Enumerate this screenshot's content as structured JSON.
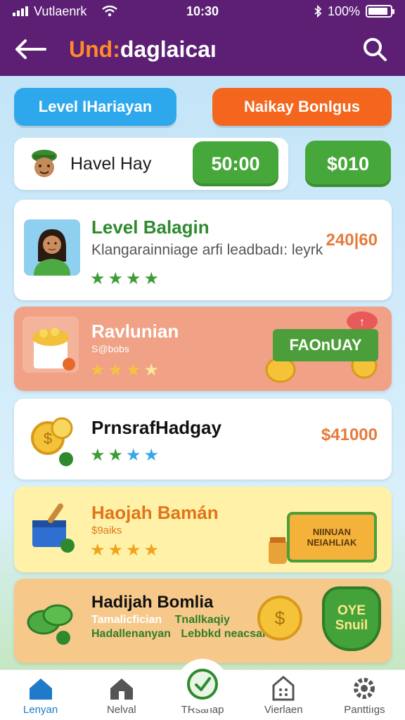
{
  "status_bar": {
    "carrier": "Vutlaenrk",
    "time": "10:30",
    "battery": "100%",
    "battery_level": 0.9
  },
  "header": {
    "title_prefix": "Und:",
    "title_rest": "daglaicaı"
  },
  "pills": {
    "level": "Level IHariayan",
    "bonus": "Naikay Bonlgus"
  },
  "user": {
    "name": "Havel Hay",
    "balance": "50:00",
    "coins": "$010"
  },
  "cards": [
    {
      "title": "Level Balagin",
      "subtitle": "Klangarainniage arfi leadbadı: leyrk",
      "price": "240|60",
      "stars": 4
    },
    {
      "title": "Ravlunian",
      "subtitle": "S@bobs",
      "ribbon": "FAOnUAY",
      "stars": 4
    },
    {
      "title": "PrnsrafHadgay",
      "price": "$41000",
      "stars": 4
    },
    {
      "title": "Haojah Bamán",
      "subtitle": "$9aiks",
      "banner_line1": "NIINUAN",
      "banner_line2": "NEIAHLIAK",
      "stars": 4
    },
    {
      "title": "Hadijah Bomlia",
      "line1a": "Tamalicfician",
      "line1b": "Tnallkaqiy",
      "line2a": "Hadallenanyan",
      "line2b": "Lebbkd neacsan",
      "shield_line1": "OYE",
      "shield_line2": "Snuil"
    }
  ],
  "nav": [
    {
      "label": "Lenyan",
      "icon": "home-icon"
    },
    {
      "label": "Nelval",
      "icon": "house-icon"
    },
    {
      "label": "TRsariap",
      "icon": "check-icon"
    },
    {
      "label": "Vierlaen",
      "icon": "calculator-icon"
    },
    {
      "label": "Panttiıgs",
      "icon": "gear-icon"
    }
  ],
  "colors": {
    "header": "#5c1f74",
    "accent_orange": "#ff8a2a",
    "green": "#46a83a",
    "blue": "#2ea8ec"
  }
}
